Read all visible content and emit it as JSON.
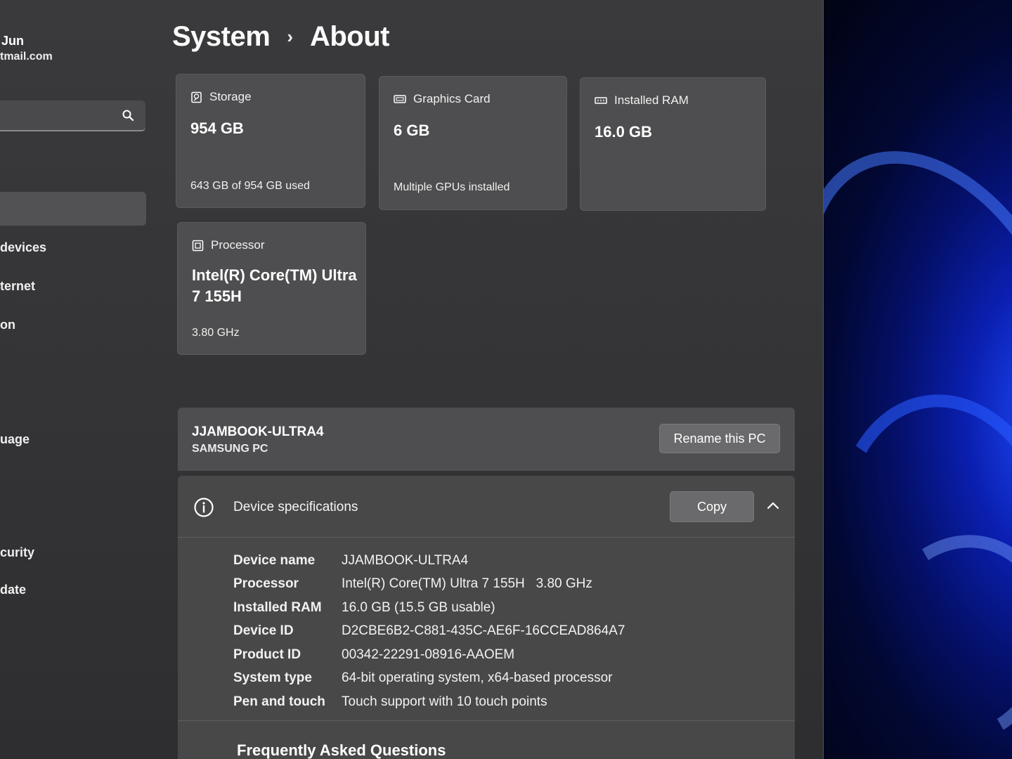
{
  "sidebar": {
    "user_name": "Jun",
    "user_email": "tmail.com",
    "search_placeholder": "",
    "items": [
      {
        "label": "devices"
      },
      {
        "label": "ternet"
      },
      {
        "label": "on"
      },
      {
        "label": "uage"
      },
      {
        "label": "curity"
      },
      {
        "label": "date"
      }
    ]
  },
  "breadcrumb": {
    "parent": "System",
    "separator": "›",
    "current": "About"
  },
  "cards": {
    "storage": {
      "title": "Storage",
      "value": "954 GB",
      "sub": "643 GB of 954 GB used"
    },
    "graphics": {
      "title": "Graphics Card",
      "value": "6 GB",
      "sub": "Multiple GPUs installed"
    },
    "ram": {
      "title": "Installed RAM",
      "value": "16.0 GB"
    },
    "processor": {
      "title": "Processor",
      "value_line1": "Intel(R) Core(TM) Ultra",
      "value_line2": "7 155H",
      "sub": "3.80 GHz"
    }
  },
  "pc": {
    "name": "JJAMBOOK-ULTRA4",
    "model": "SAMSUNG PC",
    "rename_label": "Rename this PC"
  },
  "specs": {
    "title": "Device specifications",
    "copy_label": "Copy",
    "rows": [
      {
        "key": "Device name",
        "value": "JJAMBOOK-ULTRA4"
      },
      {
        "key": "Processor",
        "value": "Intel(R) Core(TM) Ultra 7 155H   3.80 GHz"
      },
      {
        "key": "Installed RAM",
        "value": "16.0 GB (15.5 GB usable)"
      },
      {
        "key": "Device ID",
        "value": "D2CBE6B2-C881-435C-AE6F-16CCEAD864A7"
      },
      {
        "key": "Product ID",
        "value": "00342-22291-08916-AAOEM"
      },
      {
        "key": "System type",
        "value": "64-bit operating system, x64-based processor"
      },
      {
        "key": "Pen and touch",
        "value": "Touch support with 10 touch points"
      }
    ]
  },
  "faq": {
    "title": "Frequently Asked Questions"
  }
}
